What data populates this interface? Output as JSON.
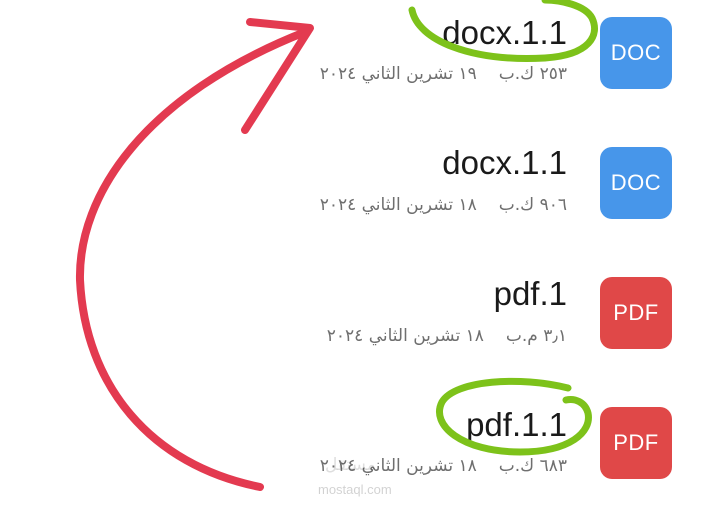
{
  "files": [
    {
      "name": "docx.1.1",
      "type_label": "DOC",
      "type_color": "#4796ea",
      "size": "٢٥٣ ك.ب",
      "date": "١٩ تشرين الثاني ٢٠٢٤",
      "highlighted": true
    },
    {
      "name": "docx.1.1",
      "type_label": "DOC",
      "type_color": "#4796ea",
      "size": "٩٠٦ ك.ب",
      "date": "١٨ تشرين الثاني ٢٠٢٤",
      "highlighted": false
    },
    {
      "name": "pdf.1",
      "type_label": "PDF",
      "type_color": "#e04848",
      "size": "٣٫١ م.ب",
      "date": "١٨ تشرين الثاني ٢٠٢٤",
      "highlighted": false
    },
    {
      "name": "pdf.1.1",
      "type_label": "PDF",
      "type_color": "#e04848",
      "size": "٦٨٣ ك.ب",
      "date": "١٨ تشرين الثاني ٢٠٢٤",
      "highlighted": true
    }
  ],
  "annotations": {
    "circle_color": "#7dc21a",
    "arrow_color": "#e33a50"
  },
  "watermark": {
    "logo_text": "مستقل",
    "url": "mostaql.com"
  }
}
